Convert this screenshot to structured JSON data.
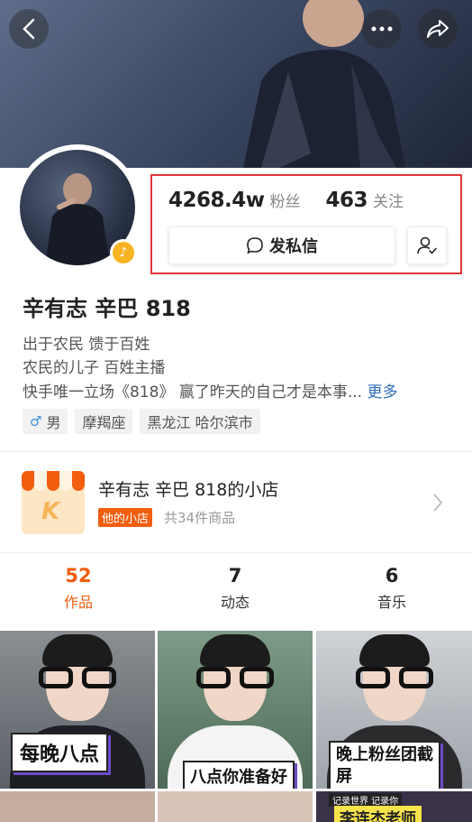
{
  "colors": {
    "accent": "#f25d0e",
    "highlight_border": "#e0363a",
    "link": "#2f6ebd",
    "music_badge": "#f8b322"
  },
  "header": {
    "back_icon": "chevron-left-icon",
    "more_icon": "ellipsis-icon",
    "share_icon": "share-arrow-icon"
  },
  "profile": {
    "name": "辛有志 辛巴 818",
    "bio_lines": [
      "出于农民 馈于百姓",
      "农民的儿子 百姓主播"
    ],
    "bio_line3": "快手唯一立场《818》 赢了昨天的自己才是本事...",
    "more_label": "更多",
    "badge_icon": "music-note-icon",
    "tags": {
      "gender_symbol": "♂",
      "gender": "男",
      "zodiac": "摩羯座",
      "location": "黑龙江 哈尔滨市"
    }
  },
  "stats": {
    "followers_count": "4268.4w",
    "followers_label": "粉丝",
    "following_count": "463",
    "following_label": "关注",
    "message_button": "发私信",
    "message_icon": "chat-bubble-icon",
    "follow_icon": "user-check-icon"
  },
  "shop": {
    "title": "辛有志 辛巴 818的小店",
    "badge": "他的小店",
    "count_text": "共34件商品",
    "icon_letter": "K"
  },
  "tabs": [
    {
      "count": "52",
      "label": "作品",
      "active": true
    },
    {
      "count": "7",
      "label": "动态",
      "active": false
    },
    {
      "count": "6",
      "label": "音乐",
      "active": false
    }
  ],
  "videos": [
    {
      "caption": "每晚八点"
    },
    {
      "caption": "八点你准备好"
    },
    {
      "caption": "晚上粉丝团截",
      "caption2": "屏"
    }
  ],
  "bottom_row": {
    "overlay_top": "记录世界 记录你",
    "overlay_name": "李连杰老师"
  }
}
